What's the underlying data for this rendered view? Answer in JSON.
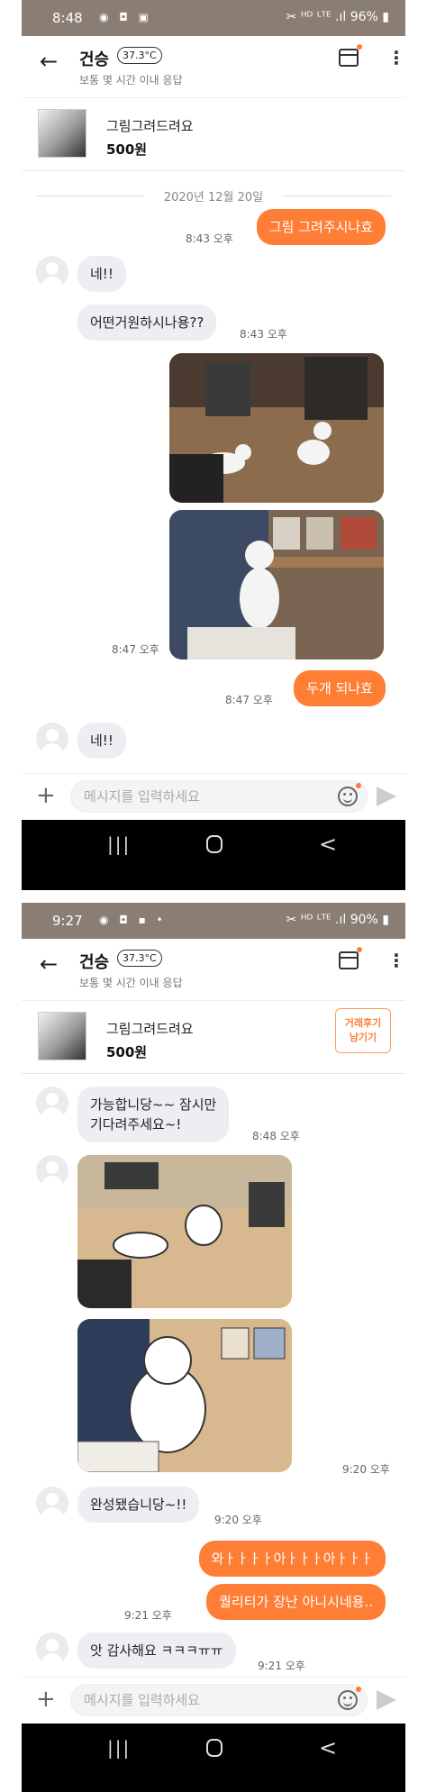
{
  "screen1": {
    "status": {
      "time": "8:48",
      "icons_left": "◉ ◘ ▣",
      "icons_right": "✂ ᴴᴰ ᴸᵀᴱ .ıl 96% ▮"
    },
    "header": {
      "name": "건승",
      "temperature": "37.3°C",
      "subtitle": "보통 몇 시간 이내 응답"
    },
    "product": {
      "name": "그림그려드려요",
      "price": "500원"
    },
    "date": "2020년 12월 20일",
    "messages": [
      {
        "from": "me",
        "text": "그림 그려주시나효",
        "time": "8:43 오후"
      },
      {
        "from": "them",
        "text": "네!!"
      },
      {
        "from": "them",
        "text": "어떤거원하시나용??",
        "time": "8:43 오후"
      },
      {
        "from": "me",
        "type": "photo",
        "alt": "cat-photo-1"
      },
      {
        "from": "me",
        "type": "photo",
        "alt": "cat-photo-2",
        "time": "8:47 오후"
      },
      {
        "from": "me",
        "text": "두개 되나효",
        "time": "8:47 오후"
      },
      {
        "from": "them",
        "text": "네!!"
      }
    ],
    "input": {
      "placeholder": "메시지를 입력하세요"
    }
  },
  "screen2": {
    "status": {
      "time": "9:27",
      "icons_left": "◉ ◘ ▪ •",
      "icons_right": "✂ ᴴᴰ ᴸᵀᴱ .ıl 90% ▮"
    },
    "header": {
      "name": "건승",
      "temperature": "37.3°C",
      "subtitle": "보통 몇 시간 이내 응답"
    },
    "product": {
      "name": "그림그려드려요",
      "price": "500원",
      "review_button_line1": "거래후기",
      "review_button_line2": "남기기"
    },
    "messages": [
      {
        "from": "them",
        "text_line1": "가능합니당~~ 잠시만",
        "text_line2": "기다려주세요~!",
        "time": "8:48 오후"
      },
      {
        "from": "them",
        "type": "drawing",
        "alt": "cat-drawing-1"
      },
      {
        "from": "them",
        "type": "drawing",
        "alt": "cat-drawing-2",
        "time": "9:20 오후"
      },
      {
        "from": "them",
        "text": "완성됐습니당~!!",
        "time": "9:20 오후"
      },
      {
        "from": "me",
        "text": "와ㅏㅏㅏㅏ아ㅏㅏㅏ아ㅏㅏㅏ"
      },
      {
        "from": "me",
        "text": "퀄리티가 장난 아니시네용..",
        "time": "9:21 오후"
      },
      {
        "from": "them",
        "text": "앗 감사해요 ㅋㅋㅋㅠㅠ",
        "time": "9:21 오후"
      }
    ],
    "input": {
      "placeholder": "메시지를 입력하세요"
    }
  },
  "navbar": {
    "recent": "|||",
    "back": "<"
  },
  "colors": {
    "accent": "#ff7e36",
    "bubble_them": "#eceef1",
    "status_bar": "#8a7e74"
  }
}
